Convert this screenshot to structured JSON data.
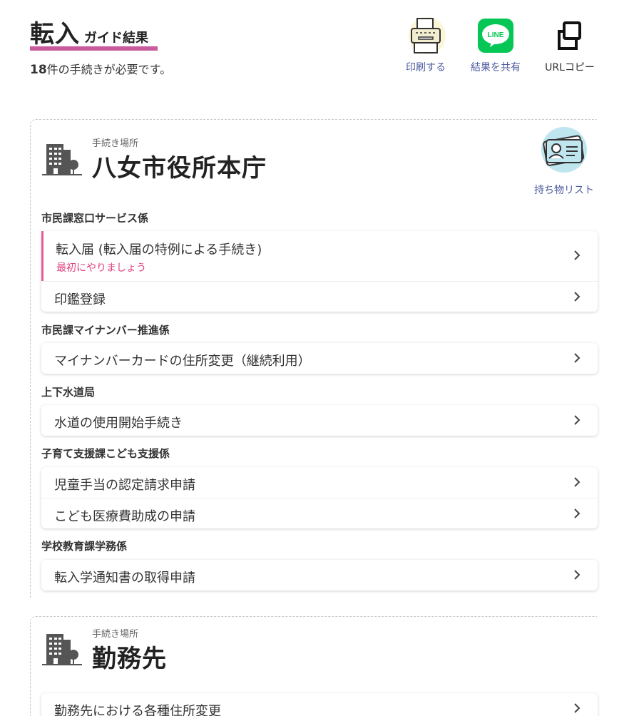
{
  "header": {
    "title_main": "転入",
    "title_sub": "ガイド結果",
    "count": "18",
    "count_suffix": "件の手続きが必要です。",
    "actions": [
      {
        "label": "印刷する",
        "icon": "printer-icon"
      },
      {
        "label": "結果を共有",
        "icon": "line-icon",
        "icon_text": "LINE",
        "color": "#06c755"
      },
      {
        "label": "URLコピー",
        "icon": "copy-icon"
      }
    ]
  },
  "sections": [
    {
      "caption": "手続き場所",
      "place": "八女市役所本庁",
      "belongings_label": "持ち物リスト",
      "departments": [
        {
          "name": "市民課窓口サービス係",
          "items": [
            {
              "label": "転入届 (転入届の特例による手続き)",
              "note": "最初にやりましょう"
            },
            {
              "label": "印鑑登録"
            }
          ]
        },
        {
          "name": "市民課マイナンバー推進係",
          "items": [
            {
              "label": "マイナンバーカードの住所変更（継続利用）"
            }
          ]
        },
        {
          "name": "上下水道局",
          "items": [
            {
              "label": "水道の使用開始手続き"
            }
          ]
        },
        {
          "name": "子育て支援課こども支援係",
          "items": [
            {
              "label": "児童手当の認定請求申請"
            },
            {
              "label": "こども医療費助成の申請"
            }
          ]
        },
        {
          "name": "学校教育課学務係",
          "items": [
            {
              "label": "転入学通知書の取得申請"
            }
          ]
        }
      ]
    },
    {
      "caption": "手続き場所",
      "place": "勤務先",
      "departments": [
        {
          "name": "",
          "items": [
            {
              "label": "勤務先における各種住所変更"
            }
          ]
        }
      ]
    }
  ],
  "colors": {
    "accent_pink": "#c75b9b",
    "link_blue": "#4b5a9e",
    "note_pink": "#e0407f"
  }
}
